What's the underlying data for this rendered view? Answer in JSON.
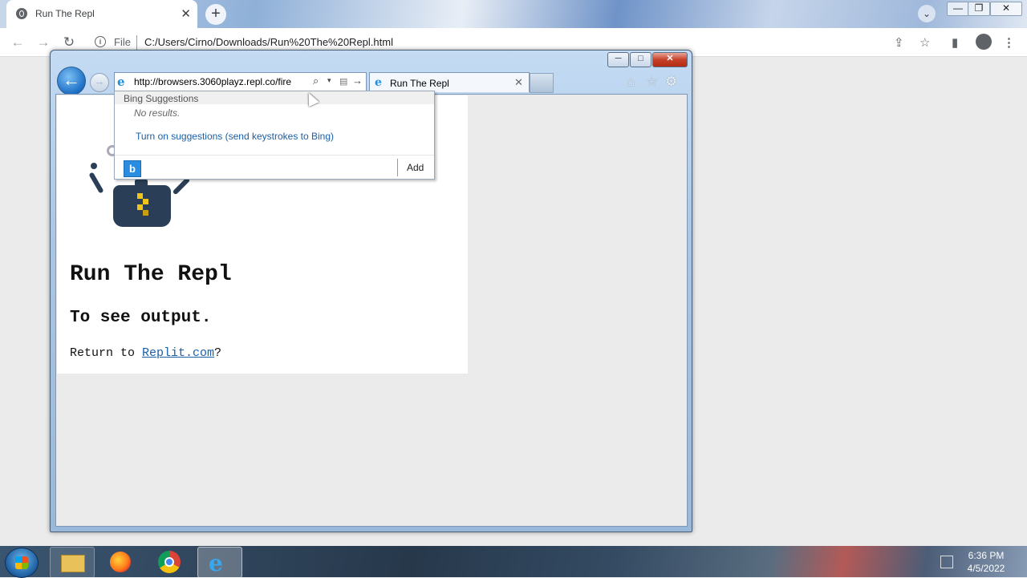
{
  "chrome": {
    "tab_title": "Run The Repl",
    "tab_close": "✕",
    "new_tab": "+",
    "tab_search": "⌄",
    "win_min": "—",
    "win_max": "❐",
    "win_close": "✕",
    "back": "←",
    "forward": "→",
    "reload": "↻",
    "info_icon": "i",
    "scheme_label": "File",
    "url": "C:/Users/Cirno/Downloads/Run%20The%20Repl.html",
    "share": "⇪",
    "star": "☆",
    "sidepanel": "▮",
    "menu": "⋮"
  },
  "ie": {
    "min": "─",
    "max": "□",
    "close": "✕",
    "back": "←",
    "forward": "→",
    "logo": "e",
    "address": "http://browsers.3060playz.repl.co/fire",
    "addr_search": "⌕",
    "addr_dropdown": "▾",
    "addr_compat": "▤",
    "addr_go": "→",
    "tab_title": "Run The Repl",
    "tab_close": "✕",
    "home": "⌂",
    "favorites": "☆",
    "tools": "⚙"
  },
  "suggestions": {
    "header": "Bing Suggestions",
    "no_results": "No results.",
    "turn_on": "Turn on suggestions (send keystrokes to Bing)",
    "bing_logo": "b",
    "add": "Add"
  },
  "page": {
    "title": "Run The Repl",
    "subtitle": "To see output.",
    "return_prefix": "Return to ",
    "return_link": "Replit.com",
    "return_suffix": "?"
  },
  "taskbar": {
    "ie_label": "e",
    "time": "6:36 PM",
    "date": "4/5/2022"
  }
}
